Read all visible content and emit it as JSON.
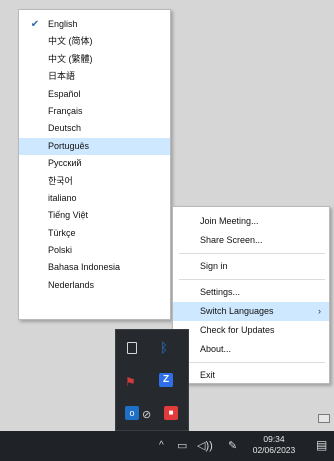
{
  "language_menu": {
    "items": [
      {
        "label": "English",
        "checked": true
      },
      {
        "label": "中文 (简体)"
      },
      {
        "label": "中文 (繁體)"
      },
      {
        "label": "日本語"
      },
      {
        "label": "Español"
      },
      {
        "label": "Français"
      },
      {
        "label": "Deutsch"
      },
      {
        "label": "Português",
        "highlighted": true
      },
      {
        "label": "Русский"
      },
      {
        "label": "한국어"
      },
      {
        "label": "italiano"
      },
      {
        "label": "Tiếng Việt"
      },
      {
        "label": "Türkçe"
      },
      {
        "label": "Polski"
      },
      {
        "label": "Bahasa Indonesia"
      },
      {
        "label": "Nederlands"
      }
    ],
    "check_glyph": "✔"
  },
  "context_menu": {
    "join_meeting": "Join Meeting...",
    "share_screen": "Share Screen...",
    "sign_in": "Sign in",
    "settings": "Settings...",
    "switch_languages": "Switch Languages",
    "submenu_arrow": "›",
    "check_updates": "Check for Updates",
    "about": "About...",
    "exit": "Exit"
  },
  "tray_panel": {
    "icons": [
      "usb-icon",
      "bluetooth-icon",
      "flag-icon",
      "zoom-icon",
      "outlook-icon",
      "camera-off-icon",
      "red-app-icon"
    ],
    "zoom_glyph": "Z",
    "outlook_glyph": "o",
    "bluetooth_glyph": "ᛒ",
    "flag_glyph": "⚑",
    "camera_glyph": "⊘",
    "red_glyph": "■"
  },
  "taskbar": {
    "time": "09:34",
    "date": "02/06/2023",
    "chevron_glyph": "^",
    "monitor_glyph": "▭",
    "speaker_glyph": "◁))",
    "pen_glyph": "✎",
    "notify_glyph": "▤"
  },
  "colors": {
    "highlight": "#cde8ff",
    "taskbar": "#1f2327",
    "zoom_blue": "#2d6fe6"
  }
}
